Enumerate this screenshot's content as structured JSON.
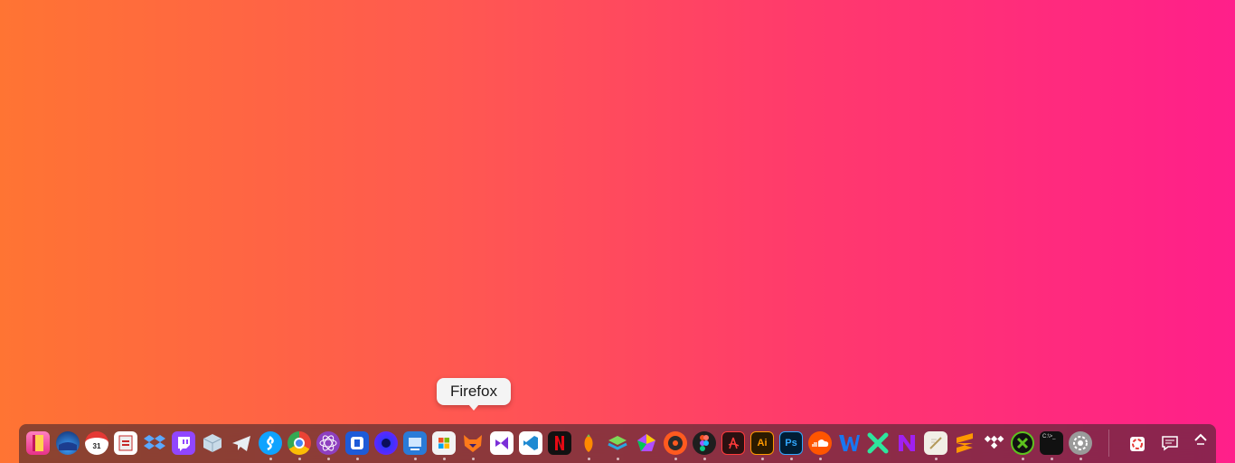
{
  "tooltip": {
    "text": "Firefox"
  },
  "dock_apps": [
    {
      "name": "ebook-icon",
      "running": false
    },
    {
      "name": "macos-monterey-icon",
      "running": false
    },
    {
      "name": "calendar-icon",
      "label": "31",
      "running": false
    },
    {
      "name": "pdf-reader-icon",
      "running": false
    },
    {
      "name": "dropbox-icon",
      "running": false
    },
    {
      "name": "twitch-icon",
      "running": false
    },
    {
      "name": "cube-app-icon",
      "running": false
    },
    {
      "name": "telegram-icon",
      "running": false
    },
    {
      "name": "shazam-icon",
      "running": true
    },
    {
      "name": "chrome-icon",
      "running": true
    },
    {
      "name": "atom-icon",
      "running": true
    },
    {
      "name": "dev-app-icon",
      "running": true
    },
    {
      "name": "firefox-nightly-icon",
      "running": false
    },
    {
      "name": "remote-desktop-icon",
      "running": true
    },
    {
      "name": "microsoft-store-icon",
      "running": true
    },
    {
      "name": "firefox-icon",
      "running": true
    },
    {
      "name": "visual-studio-icon",
      "running": false
    },
    {
      "name": "vscode-icon",
      "running": false
    },
    {
      "name": "netflix-icon",
      "running": false
    },
    {
      "name": "fl-studio-icon",
      "running": true
    },
    {
      "name": "layers-app-icon",
      "running": true
    },
    {
      "name": "colorful-shape-icon",
      "running": false
    },
    {
      "name": "music-disc-icon",
      "running": true
    },
    {
      "name": "figma-icon",
      "running": true
    },
    {
      "name": "acrobat-icon",
      "running": false
    },
    {
      "name": "illustrator-icon",
      "label": "Ai",
      "running": true
    },
    {
      "name": "photoshop-icon",
      "label": "Ps",
      "running": true
    },
    {
      "name": "soundcloud-icon",
      "running": true
    },
    {
      "name": "word-icon",
      "running": false
    },
    {
      "name": "x-app-icon",
      "running": false
    },
    {
      "name": "n-app-icon",
      "running": false
    },
    {
      "name": "notes-icon",
      "running": true
    },
    {
      "name": "sublime-text-icon",
      "running": false
    },
    {
      "name": "tidal-icon",
      "running": false
    },
    {
      "name": "xbox-icon",
      "running": true
    },
    {
      "name": "terminal-icon",
      "label": "C:\\>_",
      "running": true
    },
    {
      "name": "settings-icon",
      "running": true
    }
  ],
  "tray": [
    {
      "name": "recycle-bin-icon"
    },
    {
      "name": "notifications-icon"
    },
    {
      "name": "chevron-up-icon"
    }
  ]
}
